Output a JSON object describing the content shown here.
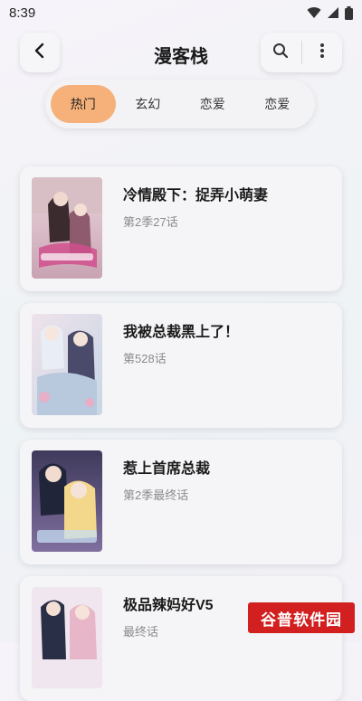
{
  "status_bar": {
    "time": "8:39",
    "icons": [
      "wifi-icon",
      "signal-icon",
      "battery-icon"
    ]
  },
  "header": {
    "title": "漫客栈",
    "back_icon": "chevron-left-icon",
    "search_icon": "search-icon",
    "more_icon": "more-vertical-icon"
  },
  "tabs": [
    {
      "label": "热门",
      "active": true
    },
    {
      "label": "玄幻",
      "active": false
    },
    {
      "label": "恋爱",
      "active": false
    },
    {
      "label": "恋爱",
      "active": false
    }
  ],
  "comics": [
    {
      "title": "冷情殿下：捉弄小萌妻",
      "episode": "第2季27话"
    },
    {
      "title": "我被总裁黑上了！",
      "episode": "第528话"
    },
    {
      "title": "惹上首席总裁",
      "episode": "第2季最终话"
    },
    {
      "title": "极品辣妈好V5",
      "episode": "最终话"
    }
  ],
  "watermark": {
    "text": "谷普软件园"
  },
  "colors": {
    "active_tab": "#f6b17a",
    "watermark": "#d21f1f",
    "subtitle": "#8b8b90"
  }
}
